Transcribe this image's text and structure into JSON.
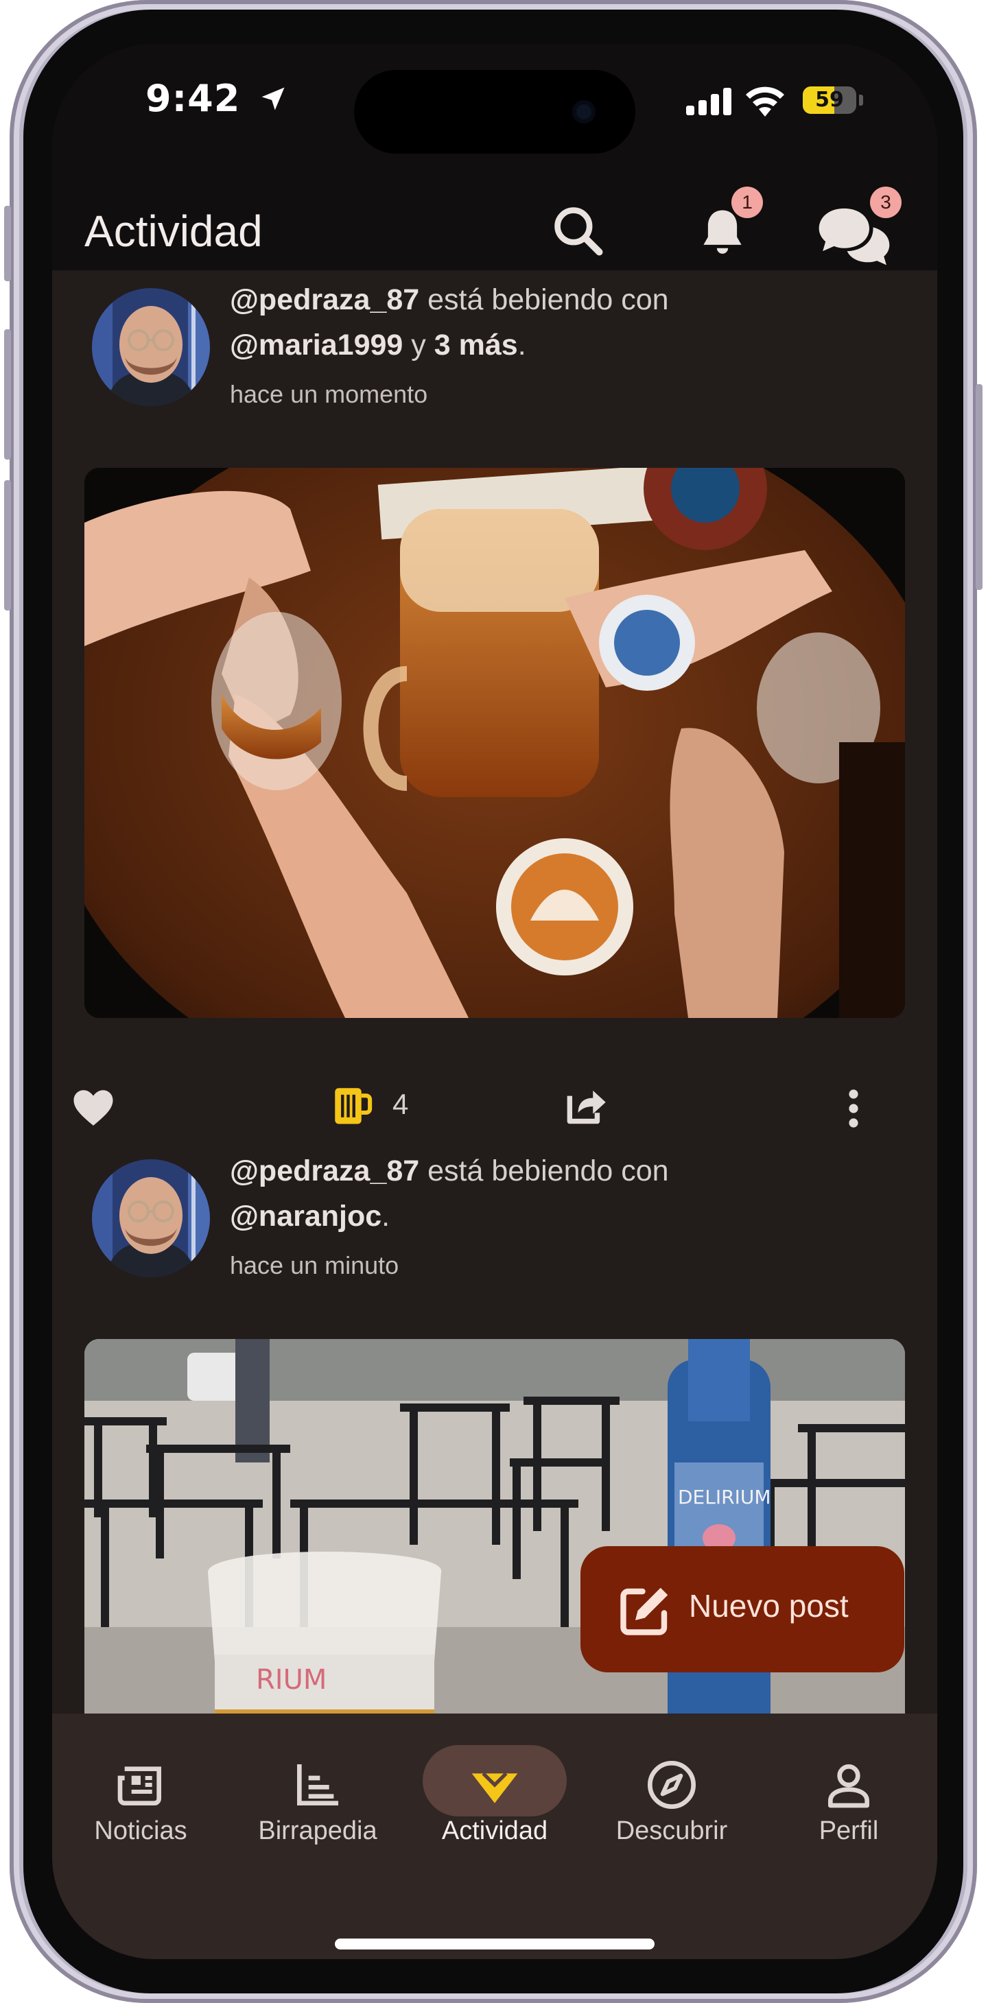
{
  "status_bar": {
    "time": "9:42",
    "battery_level": "59",
    "battery_fraction": 0.59
  },
  "header": {
    "title": "Actividad",
    "notifications_badge": "1",
    "messages_badge": "3"
  },
  "posts": [
    {
      "user": "@pedraza_87",
      "verb": " está bebiendo con",
      "with_user": "@maria1999",
      "connector": " y ",
      "others": "3 más",
      "end": ".",
      "time": "hace un momento",
      "beer_count": "4",
      "photo_description": "friends toasting beers around a wooden table"
    },
    {
      "user": "@pedraza_87",
      "verb": " está bebiendo con",
      "with_user": "@naranjoc",
      "end": ".",
      "time": "hace un minuto",
      "photo_description": "beer glass and bottle on a terrace"
    }
  ],
  "fab": {
    "label": "Nuevo post"
  },
  "bottom_nav": {
    "items": [
      {
        "label": "Noticias",
        "icon": "newspaper-icon"
      },
      {
        "label": "Birrapedia",
        "icon": "list-chart-icon"
      },
      {
        "label": "Actividad",
        "icon": "diamond-logo-icon",
        "active": true
      },
      {
        "label": "Descubrir",
        "icon": "compass-icon"
      },
      {
        "label": "Perfil",
        "icon": "person-icon"
      }
    ]
  },
  "colors": {
    "background": "#221c1b",
    "header": "#100e0e",
    "accent": "#f5c518",
    "fab": "#7a2006",
    "badge": "#f2a5a1",
    "nav_background": "#302624"
  }
}
